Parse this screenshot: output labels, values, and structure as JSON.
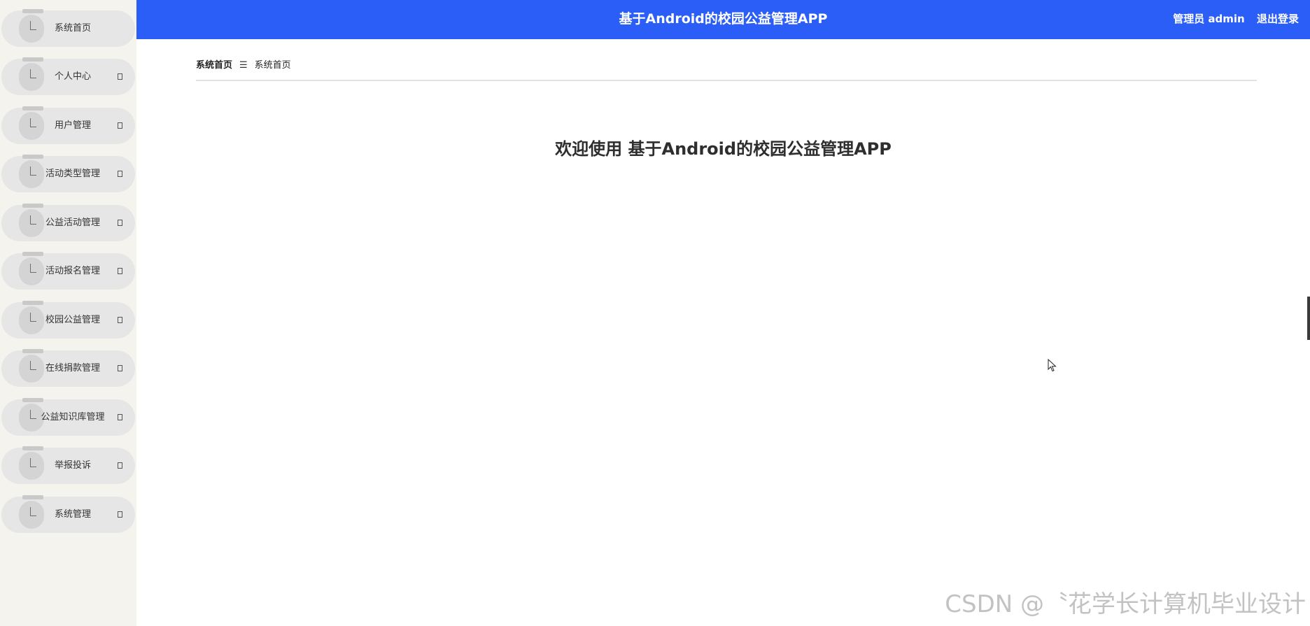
{
  "app": {
    "title": "基于Android的校园公益管理APP"
  },
  "header": {
    "user_label": "管理员 admin",
    "logout_label": "退出登录",
    "bar_color": "#2b5df7"
  },
  "sidebar": {
    "items": [
      {
        "label": "系统首页",
        "has_arrow": false
      },
      {
        "label": "个人中心",
        "has_arrow": true
      },
      {
        "label": "用户管理",
        "has_arrow": true
      },
      {
        "label": "活动类型管理",
        "has_arrow": true
      },
      {
        "label": "公益活动管理",
        "has_arrow": true
      },
      {
        "label": "活动报名管理",
        "has_arrow": true
      },
      {
        "label": "校园公益管理",
        "has_arrow": true
      },
      {
        "label": "在线捐款管理",
        "has_arrow": true
      },
      {
        "label": "公益知识库管理",
        "has_arrow": true
      },
      {
        "label": "举报投诉",
        "has_arrow": true
      },
      {
        "label": "系统管理",
        "has_arrow": true
      }
    ]
  },
  "breadcrumb": {
    "items": [
      "系统首页",
      "系统首页"
    ],
    "separator": "☰"
  },
  "main": {
    "welcome_text": "欢迎使用 基于Android的校园公益管理APP"
  },
  "watermark": {
    "text": "CSDN @〝花学长计算机毕业设计"
  },
  "icons": {
    "menu_icon": "corner-icon",
    "arrow_icon": "expand-arrow-icon",
    "cursor": "mouse-pointer-icon"
  }
}
